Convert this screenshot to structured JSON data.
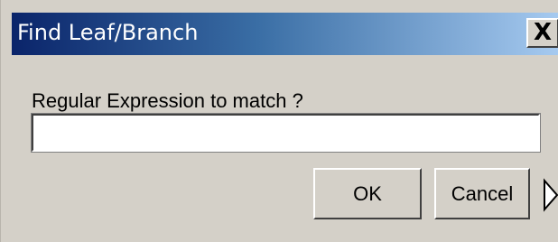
{
  "dialog": {
    "title": "Find Leaf/Branch",
    "close_label": "X",
    "prompt": "Regular Expression to match ?",
    "input_value": "",
    "ok_label": "OK",
    "cancel_label": "Cancel"
  },
  "colors": {
    "titlebar_start": "#0a246a",
    "titlebar_end": "#a6caf0",
    "window_bg": "#d4d0c8"
  },
  "icons": {
    "partial_right": "triangle-arrow-icon"
  }
}
